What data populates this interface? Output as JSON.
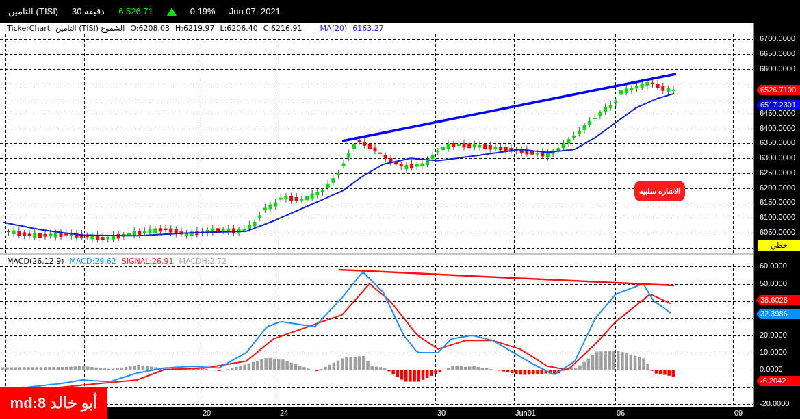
{
  "header": {
    "symbol": "التامين (TISI)",
    "interval": "30 دقيقة",
    "price": "6,526.71",
    "change": "0.19%",
    "date": "Jun 07, 2021"
  },
  "price_pane": {
    "legend": {
      "source": "TickerChart",
      "instrument": "التامين (TISI) الشموع",
      "open": "O:6208.03",
      "high": "H:6219.97",
      "low": "L:6206.40",
      "close": "C:6216.91",
      "ma_label": "MA(20)",
      "ma_value": "6163.27"
    },
    "ticks": [
      "6700.0000",
      "6650.0000",
      "6600.0000",
      "6450.0000",
      "6400.0000",
      "6350.0000",
      "6300.0000",
      "6250.0000",
      "6200.0000",
      "6150.0000",
      "6100.0000",
      "6050.0000"
    ],
    "tags": [
      {
        "text": "6526.7100",
        "color": "#ff0000"
      },
      {
        "text": "6517.2301",
        "color": "#0000ff"
      }
    ],
    "note": "الاشاره سلبيه",
    "chart_type": "خطي"
  },
  "macd_pane": {
    "legend": {
      "title": "MACD(26,12,9)",
      "macd": "MACD:29.62",
      "signal": "SIGNAL:26.91",
      "histogram": "MACDH:2.72"
    },
    "ticks": [
      "60.0000",
      "50.0000",
      "20.0000",
      "10.0000",
      "0.0000",
      "-20.0000"
    ],
    "tags": [
      {
        "text": "38.6028",
        "color": "#ff0000"
      },
      {
        "text": "32.3986",
        "color": "#0a8fff"
      },
      {
        "text": "-6.2042",
        "color": "#ff0000"
      }
    ]
  },
  "time_axis": [
    "20",
    "24",
    "30",
    "Jun01",
    "06",
    "09"
  ],
  "author_label": "md:8 أبو خالد"
}
